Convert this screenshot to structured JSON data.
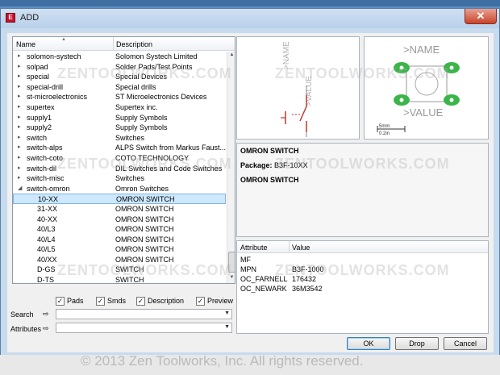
{
  "window": {
    "title": "ADD",
    "icon": "eagle-app-icon",
    "close_glyph": "✕"
  },
  "list": {
    "columns": {
      "name": "Name",
      "description": "Description"
    },
    "rows": [
      {
        "name": "solomon-systech",
        "desc": "Solomon Systech Limited",
        "level": 0,
        "expander": "▸"
      },
      {
        "name": "solpad",
        "desc": "Solder Pads/Test Points",
        "level": 0,
        "expander": "▸"
      },
      {
        "name": "special",
        "desc": "Special Devices",
        "level": 0,
        "expander": "▸"
      },
      {
        "name": "special-drill",
        "desc": "Special drills",
        "level": 0,
        "expander": "▸"
      },
      {
        "name": "st-microelectronics",
        "desc": "ST Microelectronics Devices",
        "level": 0,
        "expander": "▸"
      },
      {
        "name": "supertex",
        "desc": "Supertex inc.",
        "level": 0,
        "expander": "▸"
      },
      {
        "name": "supply1",
        "desc": "Supply Symbols",
        "level": 0,
        "expander": "▸"
      },
      {
        "name": "supply2",
        "desc": "Supply Symbols",
        "level": 0,
        "expander": "▸"
      },
      {
        "name": "switch",
        "desc": "Switches",
        "level": 0,
        "expander": "▸"
      },
      {
        "name": "switch-alps",
        "desc": "ALPS Switch from Markus Faust...",
        "level": 0,
        "expander": "▸"
      },
      {
        "name": "switch-coto",
        "desc": "COTO TECHNOLOGY",
        "level": 0,
        "expander": "▸"
      },
      {
        "name": "switch-dil",
        "desc": "DIL Switches and Code Switches",
        "level": 0,
        "expander": "▸"
      },
      {
        "name": "switch-misc",
        "desc": "Switches",
        "level": 0,
        "expander": "▸"
      },
      {
        "name": "switch-omron",
        "desc": "Omron Switches",
        "level": 0,
        "expander": "◢"
      },
      {
        "name": "10-XX",
        "desc": "OMRON SWITCH",
        "level": 1,
        "selected": true
      },
      {
        "name": "31-XX",
        "desc": "OMRON SWITCH",
        "level": 1
      },
      {
        "name": "40-XX",
        "desc": "OMRON SWITCH",
        "level": 1
      },
      {
        "name": "40/L3",
        "desc": "OMRON SWITCH",
        "level": 1
      },
      {
        "name": "40/L4",
        "desc": "OMRON SWITCH",
        "level": 1
      },
      {
        "name": "40/L5",
        "desc": "OMRON SWITCH",
        "level": 1
      },
      {
        "name": "40/XX",
        "desc": "OMRON SWITCH",
        "level": 1
      },
      {
        "name": "D-GS",
        "desc": "SWITCH",
        "level": 1
      },
      {
        "name": "D-TS",
        "desc": "SWITCH",
        "level": 1
      }
    ]
  },
  "checks": [
    {
      "label": "Pads",
      "checked": true
    },
    {
      "label": "Smds",
      "checked": true
    },
    {
      "label": "Description",
      "checked": true
    },
    {
      "label": "Preview",
      "checked": true
    }
  ],
  "search": {
    "label": "Search",
    "value": ""
  },
  "attributes_filter": {
    "label": "Attributes",
    "value": ""
  },
  "symbol_preview": {
    "name_label": ">NAME",
    "value_label": ">VALUE"
  },
  "package_preview": {
    "name_label": ">NAME",
    "value_label": ">VALUE",
    "scale_mm": "5mm",
    "scale_in": "0.2in"
  },
  "info": {
    "device_title": "OMRON SWITCH",
    "package_label": "Package:",
    "package_value": "B3F-10XX",
    "description": "OMRON SWITCH"
  },
  "attributes": {
    "columns": {
      "attribute": "Attribute",
      "value": "Value"
    },
    "rows": [
      {
        "name": "MF",
        "value": ""
      },
      {
        "name": "MPN",
        "value": "B3F-1000"
      },
      {
        "name": "OC_FARNELL",
        "value": "176432"
      },
      {
        "name": "OC_NEWARK",
        "value": "36M3542"
      }
    ]
  },
  "buttons": {
    "ok": "OK",
    "drop": "Drop",
    "cancel": "Cancel"
  },
  "watermark": "ZENTOOLWORKS.COM",
  "copyright": "© 2013 Zen Toolworks, Inc. All rights reserved.",
  "colors": {
    "accent_selection": "#cde8ff",
    "pad_green": "#3bb54a",
    "symbol_red": "#c0392b"
  }
}
